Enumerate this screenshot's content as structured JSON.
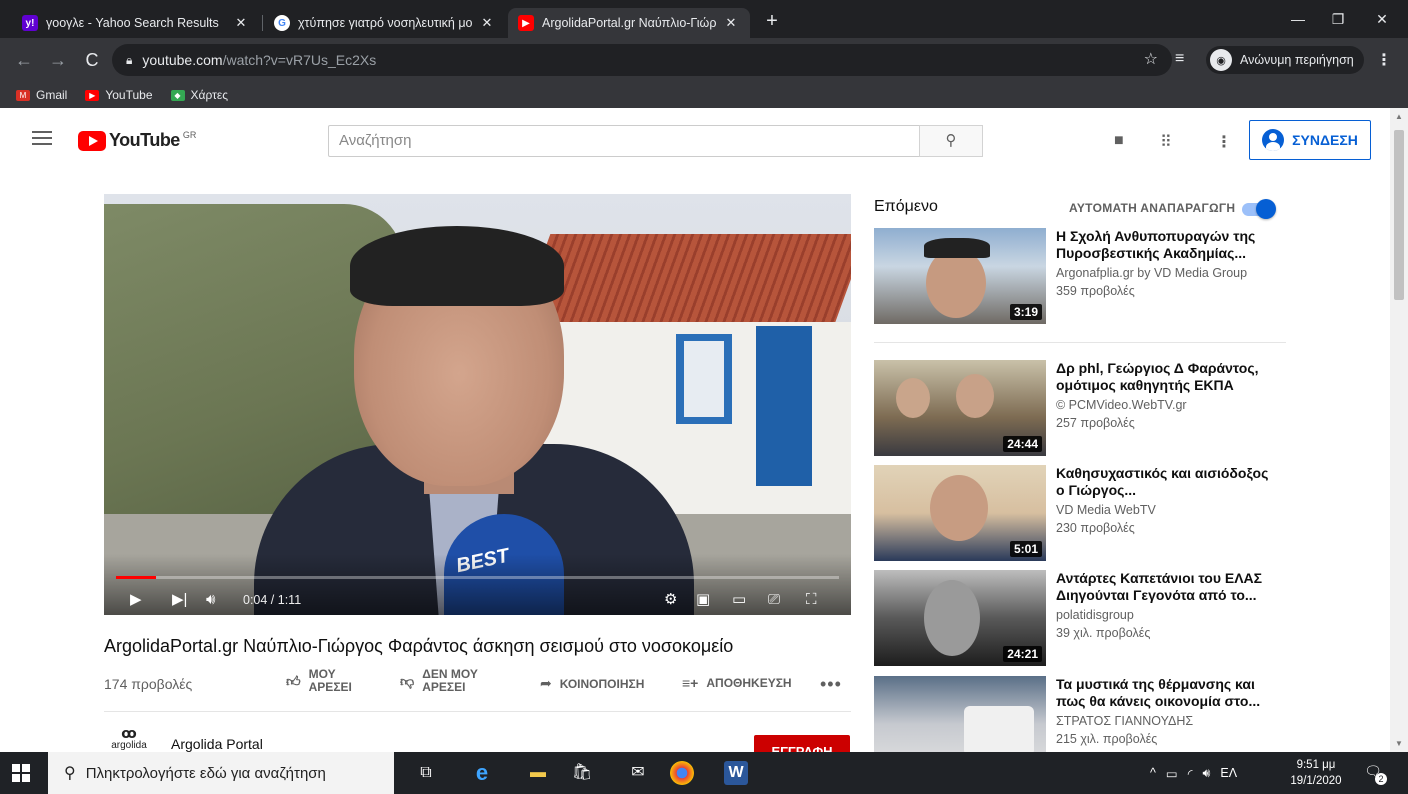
{
  "browser": {
    "tabs": [
      {
        "title": "γοογλε - Yahoo Search Results",
        "favicon": "yahoo-y",
        "favicon_color": "#6001d2"
      },
      {
        "title": "χτύπησε γιατρό νοσηλευτική μο",
        "favicon": "google-g",
        "favicon_color": "#ffffff"
      },
      {
        "title": "ArgolidaPortal.gr Ναύπλιο-Γιώργ",
        "favicon": "youtube-play",
        "favicon_color": "#ff0000"
      }
    ],
    "url_host": "youtube.com",
    "url_path": "/watch?v=vR7Us_Ec2Xs",
    "incognito_label": "Ανώνυμη περιήγηση",
    "bookmarks": [
      {
        "label": "Gmail",
        "color": "#d93025"
      },
      {
        "label": "YouTube",
        "color": "#ff0000"
      },
      {
        "label": "Χάρτες",
        "color": "#34a853"
      }
    ]
  },
  "youtube": {
    "logo_text": "YouTube",
    "country_code": "GR",
    "search_placeholder": "Αναζήτηση",
    "signin_label": "ΣΥΝΔΕΣΗ",
    "accent_color": "#065fd4"
  },
  "video": {
    "title": "ArgolidaPortal.gr Ναύπλιο-Γιώργος Φαράντος άσκηση σεισμού στο νοσοκομείο",
    "views": "174 προβολές",
    "time_display": "0:04 / 1:11",
    "progress_fraction": 0.056,
    "mic_text": "BEST",
    "actions": {
      "like_line1": "ΜΟΥ",
      "like_line2": "ΑΡΕΣΕΙ",
      "dislike_line1": "ΔΕΝ ΜΟΥ",
      "dislike_line2": "ΑΡΕΣΕΙ",
      "share": "ΚΟΙΝΟΠΟΙΗΣΗ",
      "save": "ΑΠΟΘΗΚΕΥΣΗ"
    },
    "channel": {
      "logo_text": "argolida",
      "name": "Argolida Portal",
      "subscribe_label": "ΕΓΓΡΑΦΗ"
    }
  },
  "sidebar": {
    "next_label": "Επόμενο",
    "autoplay_label": "ΑΥΤΟΜΑΤΗ ΑΝΑΠΑΡΑΓΩΓΗ",
    "autoplay_on": true,
    "recommendations": [
      {
        "title": "Η Σχολή Ανθυποπυραγών της Πυροσβεστικής Ακαδημίας...",
        "channel": "Argonafplia.gr by VD Media Group",
        "views": "359 προβολές",
        "duration": "3:19"
      },
      {
        "title": "Δρ phl, Γεώργιος Δ Φαράντος, ομότιμος καθηγητής ΕΚΠΑ",
        "channel": "© PCMVideo.WebTV.gr",
        "views": "257 προβολές",
        "duration": "24:44"
      },
      {
        "title": "Καθησυχαστικός και αισιόδοξος ο Γιώργος...",
        "channel": "VD Media WebTV",
        "views": "230 προβολές",
        "duration": "5:01"
      },
      {
        "title": "Αντάρτες Καπετάνιοι του ΕΛΑΣ Διηγούνται Γεγονότα από το...",
        "channel": "polatidisgroup",
        "views": "39 χιλ. προβολές",
        "duration": "24:21"
      },
      {
        "title": "Τα μυστικά της θέρμανσης και πως θα κάνεις οικονομία στο...",
        "channel": "ΣΤΡΑΤΟΣ ΓΙΑΝΝΟΥΔΗΣ",
        "views": "215 χιλ. προβολές",
        "duration": ""
      }
    ]
  },
  "taskbar": {
    "search_placeholder": "Πληκτρολογήστε εδώ για αναζήτηση",
    "language": "ΕΛ",
    "time": "9:51 μμ",
    "date": "19/1/2020",
    "notification_count": "2"
  }
}
